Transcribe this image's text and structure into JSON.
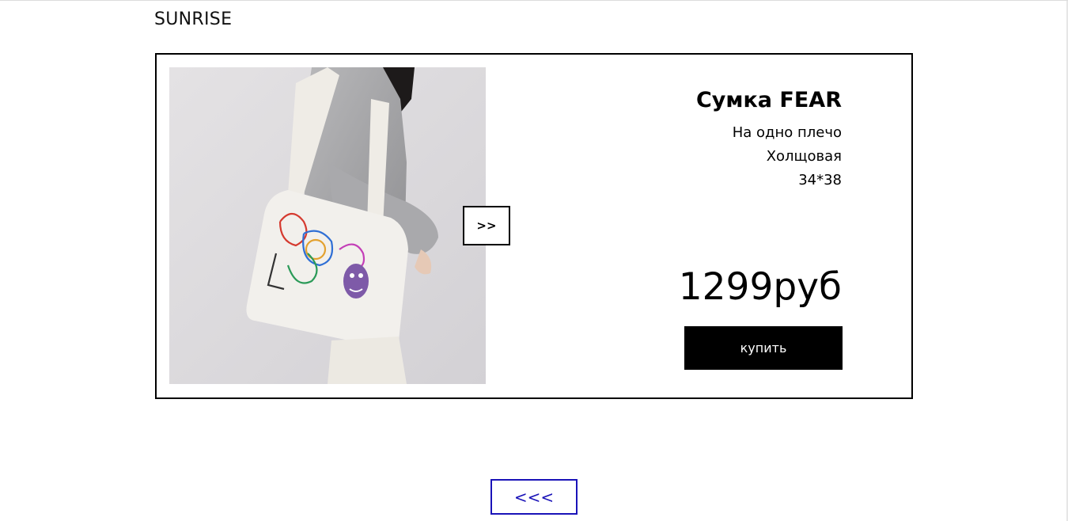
{
  "header": {
    "brand": "SUNRISE"
  },
  "product": {
    "title": "Сумка FEAR",
    "features": [
      "На одно плечо",
      "Холщовая",
      "34*38"
    ],
    "price": "1299руб",
    "buy_label": "купить",
    "next_label": ">>",
    "image_icon": "tote-bag-photo"
  },
  "navigation": {
    "back_label": "<<<"
  },
  "colors": {
    "buy_button_bg": "#000000",
    "back_button_accent": "#1a13b8"
  }
}
